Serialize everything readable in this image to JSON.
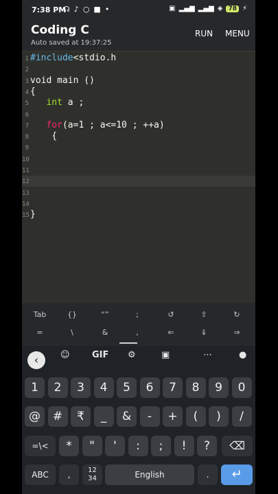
{
  "status_bar": {
    "time": "7:38 PM",
    "battery": "78"
  },
  "app": {
    "title": "Coding C",
    "subtitle": "Auto saved at 19:37:25",
    "run_label": "RUN",
    "menu_label": "MENU"
  },
  "editor": {
    "current_line": 12,
    "lines": [
      {
        "n": "1",
        "pre": "#include",
        "rest": "<stdio.h"
      },
      {
        "n": "2"
      },
      {
        "n": "3",
        "text": "void main ()"
      },
      {
        "n": "4",
        "text": "{"
      },
      {
        "n": "5",
        "indent": "   ",
        "type": "int",
        "rest": " a ;"
      },
      {
        "n": "6"
      },
      {
        "n": "7",
        "indent": "   ",
        "for": "for",
        "rest": "(a=1 ; a<=10 ; ++a)"
      },
      {
        "n": "8",
        "text": "    {"
      },
      {
        "n": "9"
      },
      {
        "n": "10"
      },
      {
        "n": "11"
      },
      {
        "n": "12"
      },
      {
        "n": "13"
      },
      {
        "n": "14"
      },
      {
        "n": "15",
        "text": "}"
      }
    ]
  },
  "extra_keys": {
    "row1": [
      "Tab",
      "{}",
      "“”",
      ";",
      "↺",
      "⇧",
      "↻"
    ],
    "row2": [
      "=",
      "\\",
      "&",
      ",",
      "⇐",
      "⇓",
      "⇒"
    ]
  },
  "keyboard": {
    "toolbar": {
      "gif_label": "GIF"
    },
    "row1": [
      "1",
      "2",
      "3",
      "4",
      "5",
      "6",
      "7",
      "8",
      "9",
      "0"
    ],
    "row2": [
      "@",
      "#",
      "₹",
      "_",
      "&",
      "-",
      "+",
      "(",
      ")",
      "/"
    ],
    "row3_left": "=\\<",
    "row3": [
      "*",
      "\"",
      "'",
      ":",
      ";",
      "!",
      "?"
    ],
    "abc_label": "ABC",
    "comma": ",",
    "numpad_label": "12\n34",
    "space_label": "English",
    "period": "."
  }
}
